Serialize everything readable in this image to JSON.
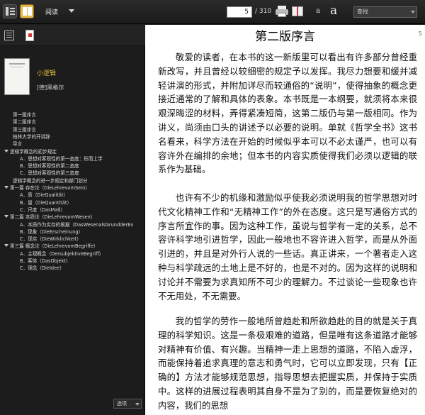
{
  "toolbar": {
    "menu_label": "阅读",
    "page_current": "5",
    "page_total": "/ 310",
    "font_small": "a",
    "font_large": "a",
    "search_placeholder": "查找"
  },
  "sidebar": {
    "book_title": "小逻辑",
    "book_author": "[德]黑格尔",
    "bottom_select": "选项",
    "toc": [
      {
        "label": "第一版序言",
        "indent": 0,
        "arrow": false
      },
      {
        "label": "第二版序言",
        "indent": 0,
        "arrow": false
      },
      {
        "label": "第三版序言",
        "indent": 0,
        "arrow": false
      },
      {
        "label": "柏林大学的开讲辞",
        "indent": 0,
        "arrow": false
      },
      {
        "label": "导言",
        "indent": 0,
        "arrow": false
      },
      {
        "label": "逻辑学概念的初步规定",
        "indent": 0,
        "arrow": true
      },
      {
        "label": "A．思想对客观性的第一态度：形而上学",
        "indent": 1,
        "arrow": false
      },
      {
        "label": "B．思想对客观性的第二态度",
        "indent": 1,
        "arrow": false
      },
      {
        "label": "C．思想对客观性的第三态度",
        "indent": 1,
        "arrow": false
      },
      {
        "label": "逻辑学概念的进一步规定和部门划分",
        "indent": 0,
        "arrow": false
      },
      {
        "label": "第一篇 存在论（DieLehrevomSein）",
        "indent": 0,
        "arrow": true
      },
      {
        "label": "A．质（DieQualität）",
        "indent": 1,
        "arrow": false
      },
      {
        "label": "B．量（DieQuantität）",
        "indent": 1,
        "arrow": false
      },
      {
        "label": "C．尺度（DasMaß）",
        "indent": 1,
        "arrow": false
      },
      {
        "label": "第二篇 本质论（DieLehrevomWesen）",
        "indent": 0,
        "arrow": true
      },
      {
        "label": "A．本质作为实存的根据（DasWesenalsGrundderEx",
        "indent": 1,
        "arrow": false
      },
      {
        "label": "B．现象（DieErscheinung）",
        "indent": 1,
        "arrow": false
      },
      {
        "label": "C．现实（DieWirklichkeit）",
        "indent": 1,
        "arrow": false
      },
      {
        "label": "第三篇 概念论（DieLehrevomBegriffe）",
        "indent": 0,
        "arrow": true
      },
      {
        "label": "A．主观概念（DersubjektiveBegriff）",
        "indent": 1,
        "arrow": false
      },
      {
        "label": "B．客体（DasObjekt）",
        "indent": 1,
        "arrow": false
      },
      {
        "label": "C．理念（DieIdee）",
        "indent": 1,
        "arrow": false
      }
    ]
  },
  "content": {
    "page_number": "5",
    "chapter_title": "第二版序言",
    "paragraphs": [
      "敬爱的读者，在本书的这一新版里可以看出有许多部分曾经重新改写，并且曾经以较细密的规定予以发挥。我尽力想要和缓并减轻讲演的形式，并附加详尽而较通俗的“说明”，使得抽象的概念更接近通常的了解和具体的表象。本书既是一本纲要，就须将本来很艰深晦涩的材料，弄得紧凑短简，这第二版仍与第一版相同。作为讲义，尚须由口头的讲述予以必要的说明。单就《哲学全书》这书名看来，科学方法在开始的时候似乎本可以不必太谨严，也可以有容许外在编排的余地；但本书的内容实质使得我们必须以逻辑的联系作为基础。",
      "也许有不少的机缘和激励似乎使我必须说明我的哲学思想对时代文化精神工作和“无精神工作”的外在态度。这只是写通俗方式的序言所宜作的事。因为这种工作，虽说与哲学有一定的关系，总不容许科学地引进哲学，因此一般地也不容许进入哲学，而是从外面引进的，并且是对外行人说的一些话。真正讲来，一个著者走入这种与科学疏远的土地上是不好的，也是不对的。因为这样的说明和讨论并不需要为求真知所不可少的理解力。不过谈论一些现象也许不无用处，不无需要。",
      "我的哲学的劳作一般地所曾趋赴和所欲趋赴的目的就是关于真理的科学知识。这是一条极艰难的道路，但是唯有这条道路才能够对精神有价值、有兴趣。当精神一走上思想的道路，不陷入虚浮，而能保持着追求真理的意志和勇气时，它可以立即发现，只有【正确的】方法才能够规范思想，指导思想去把握实质，并保持于实质中。这样的进展过程表明其自身不是为了别的，而是要恢复绝对的内容，我们的思想"
    ]
  }
}
